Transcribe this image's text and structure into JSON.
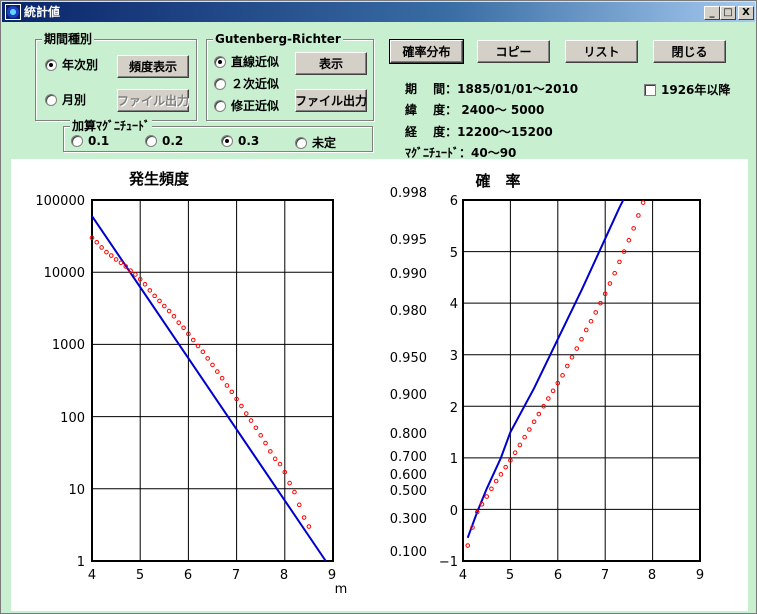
{
  "window": {
    "title": "統計値"
  },
  "title_buttons": {
    "minimize": "_",
    "maximize": "□",
    "close": "X"
  },
  "period_group": {
    "title": "期間種別",
    "options": [
      {
        "label": "年次別",
        "selected": true
      },
      {
        "label": "月別",
        "selected": false
      }
    ],
    "freq_button": "頻度表示",
    "file_button": "ファイル出力"
  },
  "gr_group": {
    "title": "Gutenberg-Richter",
    "options": [
      {
        "label": "直線近似",
        "selected": true
      },
      {
        "label": "２次近似",
        "selected": false
      },
      {
        "label": "修正近似",
        "selected": false
      }
    ],
    "show_button": "表示",
    "file_button": "ファイル出力"
  },
  "mag_group": {
    "title": "加算ﾏｸﾞﾆﾁｭｰﾄﾞ",
    "options": [
      {
        "label": "0.1",
        "selected": false
      },
      {
        "label": "0.2",
        "selected": false
      },
      {
        "label": "0.3",
        "selected": true
      },
      {
        "label": "未定",
        "selected": false
      }
    ]
  },
  "actions": {
    "prob": "確率分布",
    "copy": "コピー",
    "list": "リスト",
    "close": "閉じる"
  },
  "info": {
    "period": "期　 間：1885/01/01～2010",
    "lat": "緯　 度：  2400～ 5000",
    "lon": "経　 度：12200～15200",
    "mag": "ﾏｸﾞﾆﾁｭｰﾄﾞ：40～90"
  },
  "filter_checkbox": {
    "label": "1926年以降",
    "checked": false
  },
  "colors": {
    "fit_line": "#0000cc",
    "points": "#ff0000",
    "panel_bg": "#c8f0d0"
  },
  "chart_data": [
    {
      "type": "scatter",
      "title": "発生頻度",
      "xlabel": "m",
      "ylabel": "",
      "xlim": [
        4,
        9
      ],
      "ylim": [
        1,
        100000
      ],
      "yscale": "log",
      "xticks": [
        "4",
        "5",
        "6",
        "7",
        "8",
        "9"
      ],
      "yticks": [
        "1",
        "10",
        "100",
        "1000",
        "10000",
        "100000"
      ],
      "grid": true,
      "series": [
        {
          "kind": "line",
          "x": [
            4.0,
            8.85
          ],
          "y": [
            60000,
            1.0
          ]
        },
        {
          "kind": "points",
          "x": [
            4.0,
            4.1,
            4.2,
            4.3,
            4.4,
            4.5,
            4.6,
            4.7,
            4.8,
            4.9,
            5.0,
            5.1,
            5.2,
            5.3,
            5.4,
            5.5,
            5.6,
            5.7,
            5.8,
            5.9,
            6.0,
            6.1,
            6.2,
            6.3,
            6.4,
            6.5,
            6.6,
            6.7,
            6.8,
            6.9,
            7.0,
            7.1,
            7.2,
            7.3,
            7.4,
            7.5,
            7.6,
            7.7,
            7.8,
            7.9,
            8.0,
            8.1,
            8.2,
            8.3,
            8.4,
            8.5
          ],
          "y": [
            30000,
            26000,
            22000,
            19000,
            17000,
            15000,
            13500,
            12000,
            10500,
            9300,
            8000,
            6800,
            5600,
            4700,
            4000,
            3400,
            2900,
            2450,
            2000,
            1700,
            1400,
            1150,
            950,
            790,
            640,
            520,
            420,
            340,
            270,
            220,
            175,
            140,
            110,
            88,
            70,
            55,
            43,
            33,
            26,
            22,
            17,
            12,
            9,
            6,
            4,
            3
          ]
        }
      ]
    },
    {
      "type": "scatter",
      "title": "確　率",
      "xlabel": "",
      "ylabel": "",
      "xlim": [
        4,
        9
      ],
      "ylim": [
        -1,
        6
      ],
      "xticks": [
        "4",
        "5",
        "6",
        "7",
        "8",
        "9"
      ],
      "yticks_right": [
        "6",
        "5",
        "4",
        "3",
        "2",
        "1",
        "0",
        "−1"
      ],
      "yticks_left": [
        "0.998",
        "0.995",
        "0.990",
        "0.980",
        "0.950",
        "0.900",
        "0.800",
        "0.700",
        "0.600",
        "0.500",
        "0.300",
        "0.100"
      ],
      "grid": true,
      "series": [
        {
          "kind": "line",
          "x": [
            4.1,
            4.3,
            4.5,
            4.8,
            5.0,
            5.5,
            6.0,
            6.5,
            7.0,
            7.3,
            7.6
          ],
          "y": [
            -0.55,
            -0.05,
            0.4,
            1.0,
            1.5,
            2.35,
            3.3,
            4.25,
            5.25,
            5.85,
            6.4
          ]
        },
        {
          "kind": "points",
          "x": [
            4.1,
            4.2,
            4.3,
            4.4,
            4.5,
            4.6,
            4.7,
            4.8,
            4.9,
            5.0,
            5.1,
            5.2,
            5.3,
            5.4,
            5.5,
            5.6,
            5.7,
            5.8,
            5.9,
            6.0,
            6.1,
            6.2,
            6.3,
            6.4,
            6.5,
            6.6,
            6.7,
            6.8,
            6.9,
            7.0,
            7.1,
            7.2,
            7.3,
            7.4,
            7.5,
            7.6,
            7.7,
            7.8,
            7.9
          ],
          "y": [
            -0.7,
            -0.35,
            -0.05,
            0.1,
            0.25,
            0.4,
            0.55,
            0.68,
            0.82,
            0.95,
            1.1,
            1.25,
            1.4,
            1.55,
            1.7,
            1.85,
            2.0,
            2.15,
            2.3,
            2.45,
            2.6,
            2.78,
            2.95,
            3.12,
            3.3,
            3.48,
            3.65,
            3.82,
            4.0,
            4.18,
            4.38,
            4.58,
            4.8,
            5.0,
            5.22,
            5.45,
            5.7,
            5.95,
            6.25
          ]
        }
      ]
    }
  ]
}
